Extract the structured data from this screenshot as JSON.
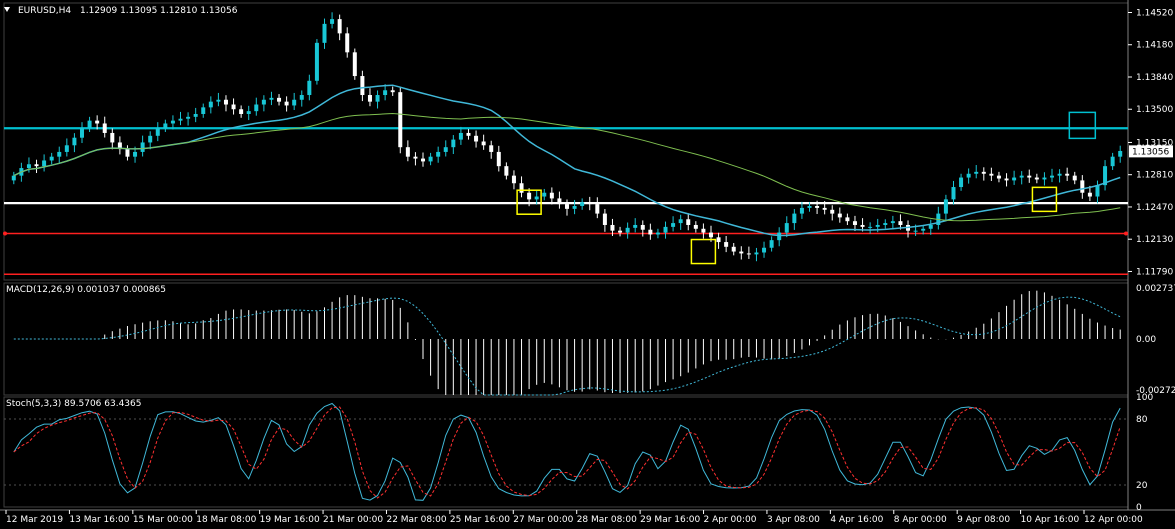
{
  "chart_data": [
    {
      "type": "candlestick",
      "title": "EURUSD,H4",
      "ohlc_readout": "1.12909 1.13095 1.12810 1.13056",
      "ylim": [
        1.117,
        1.1462
      ],
      "y_ticks": [
        "1.14520",
        "1.14180",
        "1.13840",
        "1.13500",
        "1.13150",
        "1.12810",
        "1.12470",
        "1.12130",
        "1.11790"
      ],
      "last_price": "1.13056",
      "x_tick_labels": [
        "12 Mar 2019",
        "13 Mar 16:00",
        "15 Mar 00:00",
        "18 Mar 08:00",
        "19 Mar 16:00",
        "21 Mar 00:00",
        "22 Mar 08:00",
        "25 Mar 16:00",
        "27 Mar 00:00",
        "28 Mar 08:00",
        "29 Mar 16:00",
        "2 Apr 00:00",
        "3 Apr 08:00",
        "4 Apr 16:00",
        "8 Apr 00:00",
        "9 Apr 08:00",
        "10 Apr 16:00",
        "12 Apr 00:00"
      ],
      "horizontal_levels": [
        {
          "price": 1.133,
          "color": "#00c0d0"
        },
        {
          "price": 1.1251,
          "color": "#ffffff"
        },
        {
          "price": 1.1219,
          "color": "#ff2020"
        },
        {
          "price": 1.1176,
          "color": "#ff2020"
        }
      ],
      "series": [
        {
          "type": "candles",
          "count": 180,
          "close": [
            1.128,
            1.1288,
            1.1292,
            1.129,
            1.1296,
            1.13,
            1.1305,
            1.1312,
            1.132,
            1.133,
            1.1338,
            1.1335,
            1.1325,
            1.1315,
            1.1308,
            1.13,
            1.1305,
            1.1315,
            1.1322,
            1.133,
            1.1335,
            1.1338,
            1.134,
            1.1342,
            1.1345,
            1.1352,
            1.1358,
            1.136,
            1.1355,
            1.135,
            1.1345,
            1.1348,
            1.1355,
            1.136,
            1.1362,
            1.1358,
            1.1354,
            1.136,
            1.1365,
            1.138,
            1.142,
            1.144,
            1.1445,
            1.143,
            1.141,
            1.1385,
            1.1365,
            1.1358,
            1.1365,
            1.137,
            1.1368,
            1.131,
            1.13,
            1.1298,
            1.1295,
            1.13,
            1.1305,
            1.131,
            1.1318,
            1.1325,
            1.1322,
            1.1316,
            1.1312,
            1.1305,
            1.129,
            1.128,
            1.1272,
            1.1262,
            1.1255,
            1.1258,
            1.1262,
            1.1256,
            1.125,
            1.1245,
            1.1248,
            1.1252,
            1.125,
            1.124,
            1.1228,
            1.1222,
            1.122,
            1.1225,
            1.1228,
            1.1223,
            1.1218,
            1.122,
            1.1226,
            1.123,
            1.1234,
            1.1228,
            1.1224,
            1.122,
            1.1215,
            1.121,
            1.1205,
            1.12,
            1.1198,
            1.1197,
            1.1199,
            1.1204,
            1.1212,
            1.122,
            1.123,
            1.124,
            1.1246,
            1.1248,
            1.1246,
            1.1244,
            1.124,
            1.1236,
            1.1232,
            1.1228,
            1.1226,
            1.1226,
            1.1228,
            1.123,
            1.1232,
            1.1228,
            1.1222,
            1.1222,
            1.1224,
            1.1228,
            1.124,
            1.1255,
            1.1268,
            1.1278,
            1.1282,
            1.1284,
            1.1282,
            1.128,
            1.1277,
            1.1275,
            1.1278,
            1.128,
            1.1278,
            1.1276,
            1.1278,
            1.128,
            1.1282,
            1.128,
            1.1275,
            1.1262,
            1.1258,
            1.127,
            1.129,
            1.13,
            1.1306
          ],
          "name": ""
        },
        {
          "type": "line",
          "name": "",
          "color": "#40b8d8"
        },
        {
          "type": "line",
          "name": "",
          "color": "#7fbf50"
        }
      ],
      "annotations": [
        {
          "type": "box",
          "color": "#ffff00",
          "center_price": 1.1252
        },
        {
          "type": "box",
          "color": "#ffff00",
          "center_price": 1.12
        },
        {
          "type": "box",
          "color": "#ffff00",
          "center_price": 1.1255
        },
        {
          "type": "box",
          "color": "#00c0d0",
          "center_price": 1.1333
        }
      ]
    },
    {
      "type": "bar",
      "title": "MACD(12,26,9) 0.001037 0.000865",
      "y_ticks": [
        "0.002737",
        "0.00",
        "-0.002723"
      ],
      "ylim": [
        -0.003,
        0.003
      ]
    },
    {
      "type": "line",
      "title": "Stoch(5,3,3) 89.5706 63.4365",
      "y_ticks": [
        "100",
        "80",
        "20",
        "0"
      ],
      "ylim": [
        0,
        100
      ],
      "series": [
        {
          "name": "",
          "color": "#40b8d8"
        },
        {
          "name": "",
          "color": "#ff3030"
        }
      ]
    }
  ]
}
